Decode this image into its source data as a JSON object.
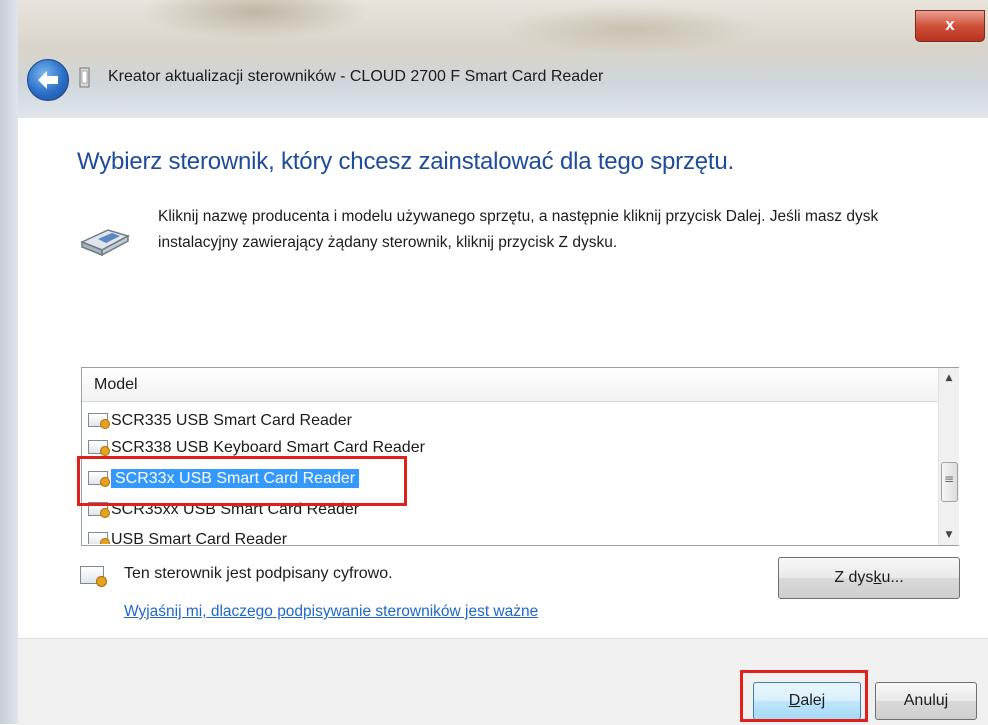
{
  "window": {
    "close_label": "x",
    "title": "Kreator aktualizacji sterowników - CLOUD 2700 F Smart Card Reader"
  },
  "main": {
    "heading": "Wybierz sterownik, który chcesz zainstalować dla tego sprzętu.",
    "instructions": "Kliknij nazwę producenta i modelu używanego sprzętu, a następnie kliknij przycisk Dalej. Jeśli masz dysk instalacyjny zawierający żądany sterownik, kliknij przycisk Z dysku."
  },
  "model_list": {
    "header": "Model",
    "items": [
      {
        "label": "SCR335 USB Smart Card Reader"
      },
      {
        "label": "SCR338 USB Keyboard Smart Card Reader"
      },
      {
        "label": "SCR33x USB Smart Card Reader"
      },
      {
        "label": "SCR35xx USB Smart Card Reader"
      },
      {
        "label": "USB Smart Card Reader"
      }
    ],
    "selected_item": "SCR33x USB Smart Card Reader"
  },
  "signature": {
    "text": "Ten sterownik jest podpisany cyfrowo.",
    "link": "Wyjaśnij mi, dlaczego podpisywanie sterowników jest ważne"
  },
  "buttons": {
    "have_disk_pre": "Z dys",
    "have_disk_ul": "k",
    "have_disk_post": "u...",
    "next_ul": "D",
    "next_post": "alej",
    "cancel": "Anuluj"
  },
  "colors": {
    "heading": "#1e4c9a",
    "link": "#1f67c9",
    "selection": "#3399ff",
    "annotation": "#e0201c"
  },
  "icons": [
    "back-arrow-icon",
    "driver-wizard-icon",
    "hardware-icon",
    "certificate-icon"
  ]
}
